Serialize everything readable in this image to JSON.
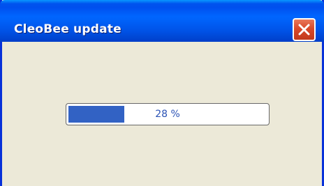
{
  "window": {
    "title": "CleoBee update"
  },
  "progress": {
    "label": "28 %",
    "fraction": 0.28
  },
  "icons": {
    "close": "close-icon"
  },
  "colors": {
    "titlebar": "#0055ea",
    "close_button": "#d9492a",
    "progress_fill": "#3262c4",
    "background": "#ece9d8"
  }
}
